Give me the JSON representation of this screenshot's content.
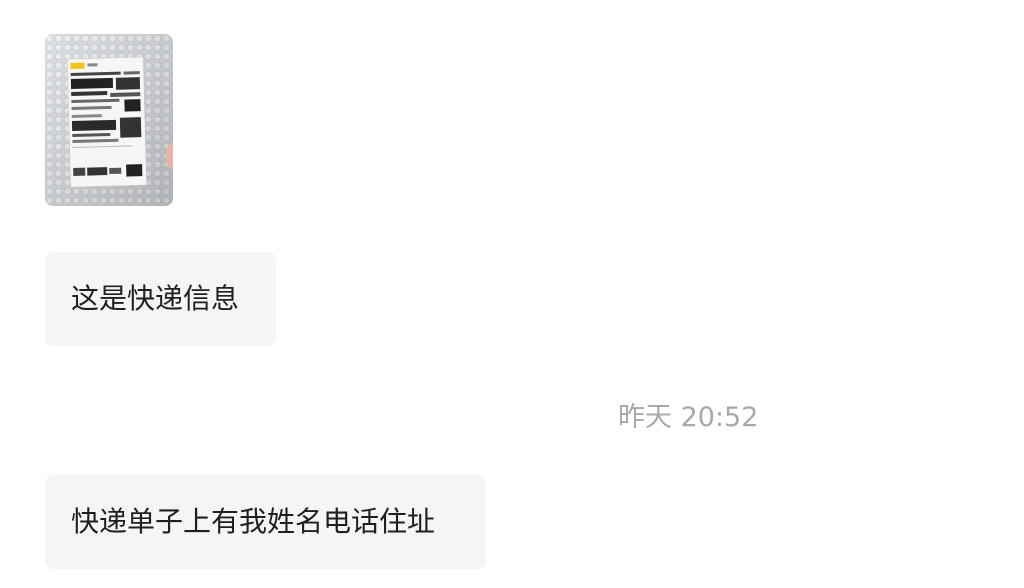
{
  "messages": [
    {
      "type": "image",
      "content": "package label photo",
      "label_brand_color": "#f2c318"
    },
    {
      "type": "text",
      "text": "这是快递信息"
    },
    {
      "type": "text",
      "text": "快递单子上有我姓名电话住址"
    }
  ],
  "timestamp": "昨天 20:52",
  "colors": {
    "bubble": "#f4f5f7",
    "timestamp": "#a8a8a8",
    "text": "#1f1f1f"
  }
}
